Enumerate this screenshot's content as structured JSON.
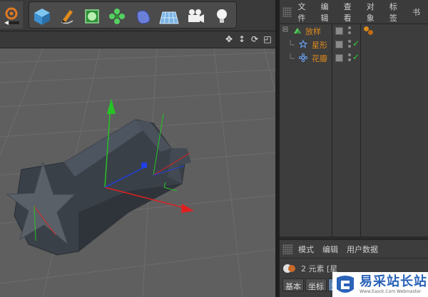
{
  "toolbar": {
    "tools": [
      {
        "name": "render-settings"
      },
      {
        "name": "cube-primitive"
      },
      {
        "name": "pen-spline"
      },
      {
        "name": "subdivision-generator"
      },
      {
        "name": "cloner"
      },
      {
        "name": "deformer"
      },
      {
        "name": "floor"
      },
      {
        "name": "camera"
      },
      {
        "name": "light"
      }
    ]
  },
  "viewport": {
    "nav_icons": [
      "move-view-icon",
      "zoom-view-icon",
      "rotate-view-icon",
      "toggle-layout-icon"
    ],
    "colors": {
      "x_axis": "#e02020",
      "y_axis": "#26c226",
      "z_axis": "#2040e0",
      "object": "#3d434b",
      "floor": "#5c5c5c"
    }
  },
  "object_manager": {
    "menu": [
      "文件",
      "编辑",
      "查看",
      "对象",
      "标签",
      "书"
    ],
    "objects": [
      {
        "name": "放样",
        "level": 0,
        "color": "#e08a1e",
        "icon": "loft-icon"
      },
      {
        "name": "星形",
        "level": 1,
        "color": "#e08a1e",
        "icon": "star-spline-icon"
      },
      {
        "name": "花瓣",
        "level": 1,
        "color": "#e08a1e",
        "icon": "flower-spline-icon"
      }
    ]
  },
  "attribute_manager": {
    "menu": [
      "模式",
      "编辑",
      "用户数据"
    ],
    "info": "2 元素 [星",
    "tabs": [
      "基本",
      "坐标",
      "对"
    ]
  },
  "watermark": {
    "main": "易采站长站",
    "sub": "Www.Easck.Com Webmaster"
  }
}
